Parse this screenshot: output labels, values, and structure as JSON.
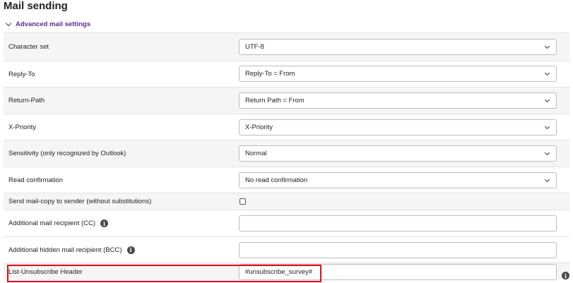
{
  "page": {
    "title": "Mail sending",
    "section_toggle": "Advanced mail settings"
  },
  "rows": {
    "charset": {
      "label": "Character set",
      "value": "UTF-8"
    },
    "reply_to": {
      "label": "Reply-To",
      "value": "Reply-To = From"
    },
    "return_path": {
      "label": "Return-Path",
      "value": "Return Path = From"
    },
    "priority": {
      "label": "X-Priority",
      "value": "X-Priority"
    },
    "sensitivity": {
      "label": "Sensitivity (only recognized by Outlook)",
      "value": "Normal"
    },
    "read_confirmation": {
      "label": "Read confirmation",
      "value": "No read confirmation"
    },
    "copy_to_sender": {
      "label": "Send mail-copy to sender (without substitutions)",
      "checked": false
    },
    "cc": {
      "label": "Additional mail recipient (CC)",
      "value": ""
    },
    "bcc": {
      "label": "Additional hidden mail recipient (BCC)",
      "value": ""
    },
    "list_unsubscribe": {
      "label": "List-Unsubscribe Header",
      "value": "#unsubscribe_survey#"
    }
  },
  "icons": {
    "info": "i"
  },
  "colors": {
    "accent": "#5a2d91",
    "highlight": "#e30d18",
    "row_alt": "#f5f5f5"
  }
}
